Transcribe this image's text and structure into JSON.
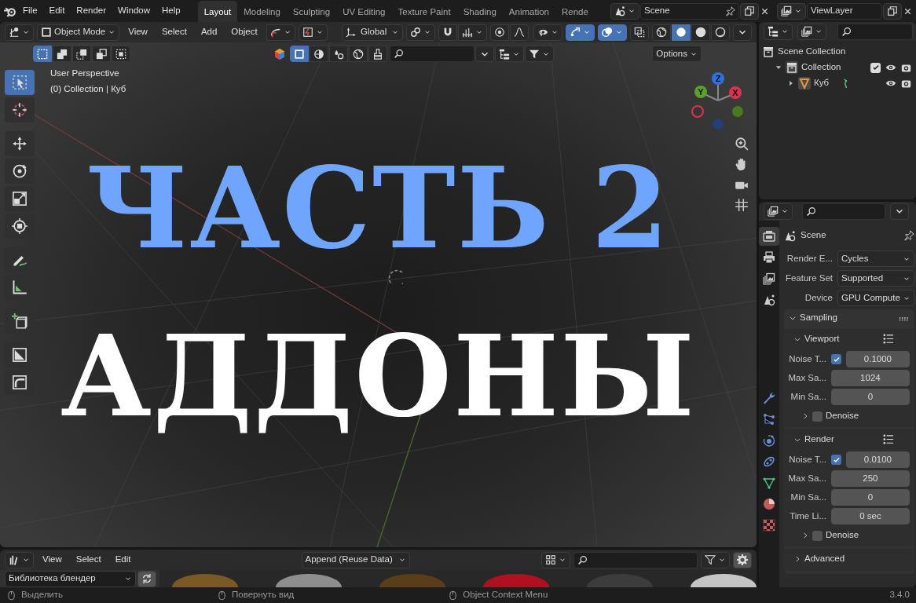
{
  "topbar": {
    "menus": [
      "File",
      "Edit",
      "Render",
      "Window",
      "Help"
    ],
    "workspaces": [
      {
        "label": "Layout",
        "selected": true
      },
      {
        "label": "Modeling",
        "selected": false
      },
      {
        "label": "Sculpting",
        "selected": false
      },
      {
        "label": "UV Editing",
        "selected": false
      },
      {
        "label": "Texture Paint",
        "selected": false
      },
      {
        "label": "Shading",
        "selected": false
      },
      {
        "label": "Animation",
        "selected": false
      },
      {
        "label": "Rende",
        "selected": false
      }
    ],
    "scene": "Scene",
    "view_layer": "ViewLayer"
  },
  "viewport": {
    "mode": "Object Mode",
    "menus": [
      "View",
      "Select",
      "Add",
      "Object"
    ],
    "orientation": "Global",
    "options": "Options",
    "view_name": "User Perspective",
    "context": "(0) Collection | Куб",
    "select_modes": [
      {
        "kind": "new",
        "selected": true
      },
      {
        "kind": "extend",
        "selected": false
      },
      {
        "kind": "subtract",
        "selected": false
      },
      {
        "kind": "invert",
        "selected": false
      },
      {
        "kind": "intersect",
        "selected": false
      }
    ],
    "shading": [
      {
        "kind": "wireframe",
        "selected": false
      },
      {
        "kind": "solid",
        "selected": true
      },
      {
        "kind": "material",
        "selected": false
      },
      {
        "kind": "rendered",
        "selected": false
      }
    ],
    "tools": [
      {
        "kind": "select",
        "selected": true
      },
      {
        "kind": "cursor",
        "selected": false
      },
      {
        "kind": "move",
        "selected": false
      },
      {
        "kind": "rotate",
        "selected": false
      },
      {
        "kind": "scale",
        "selected": false
      },
      {
        "kind": "transform",
        "selected": false
      },
      {
        "kind": "annotate",
        "selected": false
      },
      {
        "kind": "measure",
        "selected": false
      },
      {
        "kind": "add-cube",
        "selected": false
      },
      {
        "kind": "shear",
        "selected": false
      },
      {
        "kind": "bend",
        "selected": false
      }
    ],
    "gizmo": [
      "Z",
      "Y",
      "X"
    ],
    "title_lines": [
      {
        "text": "ЧАСТЬ 2",
        "color": "#6fa5ff"
      },
      {
        "text": "АДДОНЫ",
        "color": "#ffffff"
      }
    ]
  },
  "outliner": {
    "items": [
      {
        "label": "Scene Collection",
        "kind": "scene",
        "children": [
          {
            "label": "Collection",
            "kind": "collection",
            "expanded": true,
            "checked": true,
            "children": [
              {
                "label": "Куб",
                "kind": "mesh",
                "expanded": false
              }
            ]
          }
        ]
      }
    ]
  },
  "properties": {
    "tabs": [
      {
        "kind": "render",
        "selected": true
      },
      {
        "kind": "output",
        "selected": false
      },
      {
        "kind": "view-layer",
        "selected": false
      },
      {
        "kind": "scene",
        "selected": false
      },
      {
        "kind": "modifiers",
        "selected": false
      },
      {
        "kind": "particles",
        "selected": false
      },
      {
        "kind": "physics",
        "selected": false
      },
      {
        "kind": "constraints",
        "selected": false
      },
      {
        "kind": "data",
        "selected": false
      },
      {
        "kind": "material",
        "selected": false
      },
      {
        "kind": "texture",
        "selected": false
      }
    ],
    "context": "Scene",
    "fields": [
      {
        "label": "Render E...",
        "value": "Cycles"
      },
      {
        "label": "Feature Set",
        "value": "Supported"
      },
      {
        "label": "Device",
        "value": "GPU Compute"
      }
    ],
    "panels": [
      {
        "title": "Sampling",
        "expanded": true,
        "subpanels": [
          {
            "title": "Viewport",
            "expanded": true,
            "rows": [
              {
                "kind": "toggle-number",
                "label": "Noise T...",
                "checked": true,
                "value": "0.1000"
              },
              {
                "kind": "number",
                "label": "Max Sa...",
                "value": "1024"
              },
              {
                "kind": "number",
                "label": "Min Sa...",
                "value": "0"
              },
              {
                "kind": "subpanel",
                "label": "Denoise",
                "expanded": false,
                "checked": false
              }
            ]
          },
          {
            "title": "Render",
            "expanded": true,
            "rows": [
              {
                "kind": "toggle-number",
                "label": "Noise T...",
                "checked": true,
                "value": "0.0100"
              },
              {
                "kind": "number",
                "label": "Max Sa...",
                "value": "250"
              },
              {
                "kind": "number",
                "label": "Min Sa...",
                "value": "0"
              },
              {
                "kind": "number",
                "label": "Time Li...",
                "value": "0 sec"
              },
              {
                "kind": "subpanel",
                "label": "Denoise",
                "expanded": false,
                "checked": false
              }
            ]
          },
          {
            "title": "Advanced",
            "expanded": false
          }
        ]
      }
    ]
  },
  "assets": {
    "menus": [
      "View",
      "Select",
      "Edit"
    ],
    "import_method": "Append (Reuse Data)",
    "library": "Библиотека блендер",
    "items": [
      {
        "color": "#7a5a22"
      },
      {
        "color": "#8e8e8e"
      },
      {
        "color": "#5a3e1a"
      },
      {
        "color": "#b01020"
      },
      {
        "color": "#3c3c3c"
      },
      {
        "color": "#c4c4c4"
      }
    ]
  },
  "status_bar": {
    "hints": [
      "Выделить",
      "Повернуть вид",
      "Object Context Menu"
    ],
    "version": "3.4.0"
  }
}
